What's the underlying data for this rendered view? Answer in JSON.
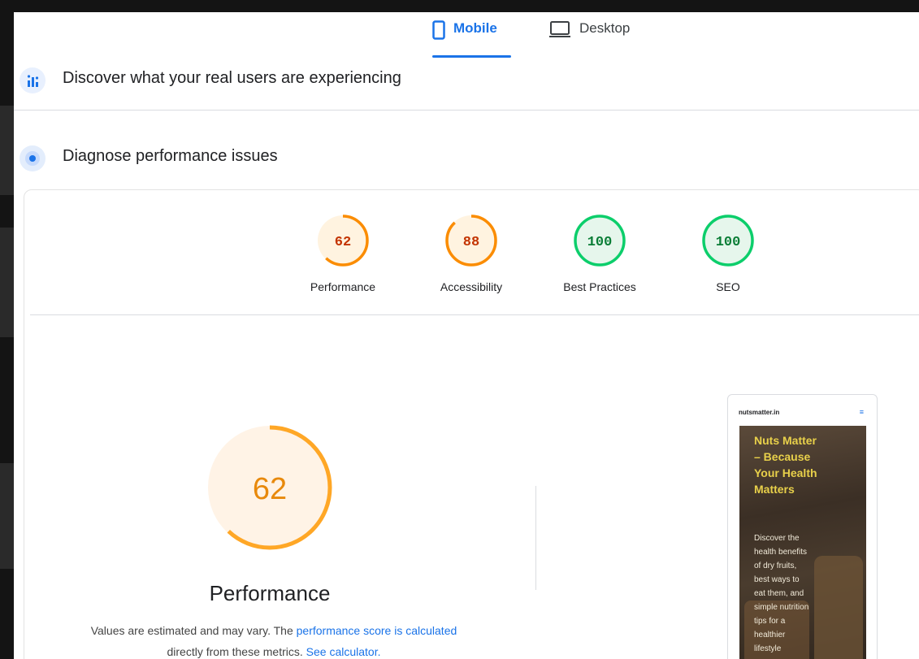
{
  "tabs": {
    "mobile": "Mobile",
    "desktop": "Desktop",
    "active": "Mobile"
  },
  "sections": {
    "real_users": "Discover what your real users are experiencing",
    "diagnose": "Diagnose performance issues"
  },
  "scores": [
    {
      "label": "Performance",
      "value": "62",
      "fraction": 0.62,
      "color": "#fb8c00",
      "text_color": "#c33300",
      "bg": "#fff3e0"
    },
    {
      "label": "Accessibility",
      "value": "88",
      "fraction": 0.88,
      "color": "#fb8c00",
      "text_color": "#c33300",
      "bg": "#fff3e0"
    },
    {
      "label": "Best Practices",
      "value": "100",
      "fraction": 1.0,
      "color": "#0cce6b",
      "text_color": "#0a7d36",
      "bg": "#e6f6ec"
    },
    {
      "label": "SEO",
      "value": "100",
      "fraction": 1.0,
      "color": "#0cce6b",
      "text_color": "#0a7d36",
      "bg": "#e6f6ec"
    }
  ],
  "main_score": {
    "value": "62",
    "fraction": 0.62,
    "label": "Performance",
    "color": "#ffa726",
    "bg": "#fff3e6",
    "text_color": "#e8890c"
  },
  "note": {
    "prefix": "Values are estimated and may vary. The ",
    "link1": "performance score is calculated",
    "mid": "directly from these metrics. ",
    "link2": "See calculator."
  },
  "screenshot": {
    "site": "nutsmatter.in",
    "menu_icon": "hamburger-icon",
    "headline": "Nuts Matter – Because Your Health Matters",
    "body": "Discover the health benefits of dry fruits, best ways to eat them, and simple nutrition tips for a healthier lifestyle"
  }
}
